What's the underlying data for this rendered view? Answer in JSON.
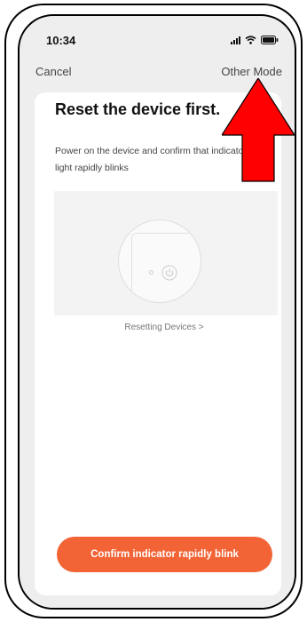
{
  "status_bar": {
    "time": "10:34",
    "icons": [
      "signal-icon",
      "wifi-icon",
      "battery-icon"
    ]
  },
  "nav": {
    "cancel_label": "Cancel",
    "other_mode_label": "Other Mode"
  },
  "content": {
    "title": "Reset the device first.",
    "subtitle": "Power on the device and confirm that indicator light rapidly blinks",
    "device_image": "device-illustration",
    "resetting_link": "Resetting Devices >",
    "confirm_button_label": "Confirm indicator rapidly blink"
  },
  "annotation": {
    "arrow": "red-up-arrow-icon",
    "color": "#ff0000"
  },
  "colors": {
    "accent": "#f26436",
    "background": "#eeeeee",
    "card": "#ffffff"
  }
}
